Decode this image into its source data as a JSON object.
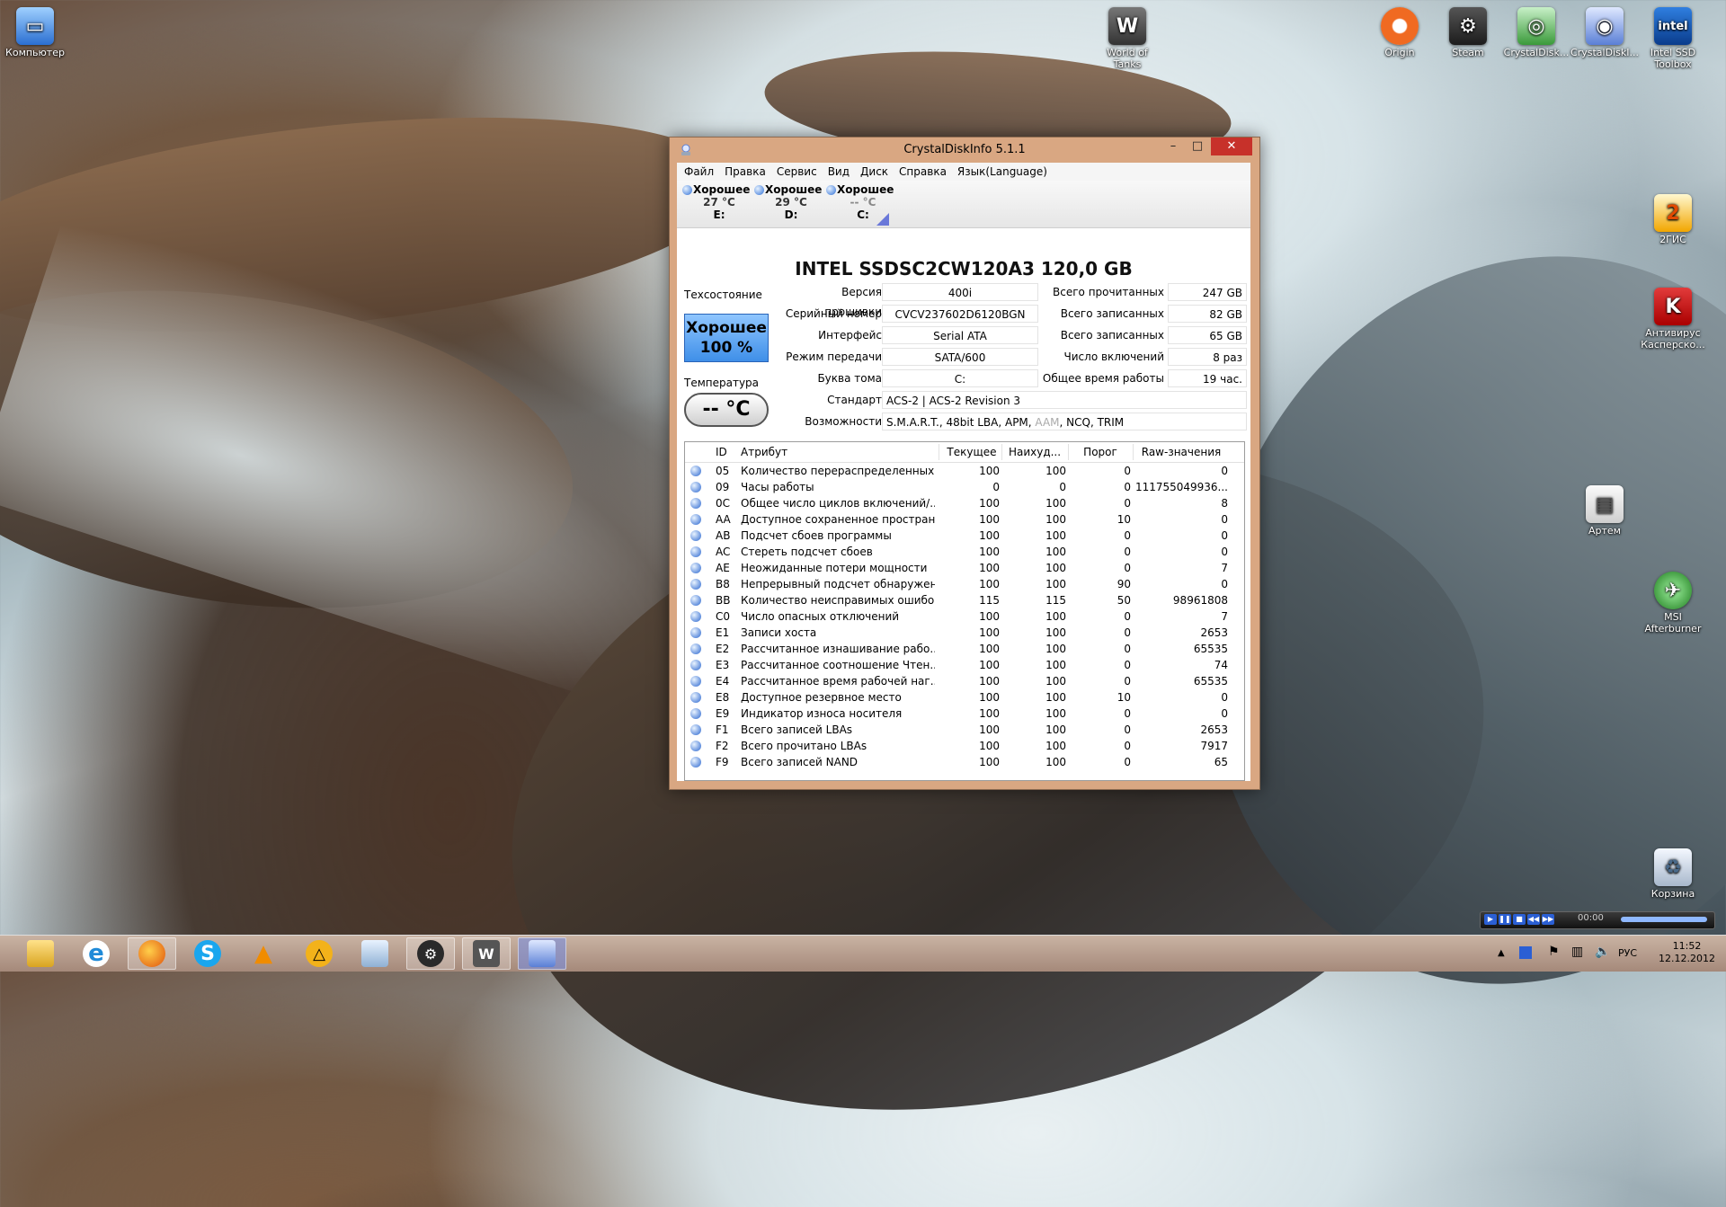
{
  "desktop": {
    "icons": [
      {
        "label": "Компьютер"
      },
      {
        "label": "World of Tanks"
      },
      {
        "label": "Origin"
      },
      {
        "label": "Steam"
      },
      {
        "label": "CrystalDisk..."
      },
      {
        "label": "CrystalDiskI..."
      },
      {
        "label": "Intel SSD Toolbox"
      },
      {
        "label": "2ГИС"
      },
      {
        "label": "Антивирус Касперско..."
      },
      {
        "label": "Артем"
      },
      {
        "label": "MSI Afterburner"
      },
      {
        "label": "Корзина"
      }
    ]
  },
  "window": {
    "title": "CrystalDiskInfo 5.1.1",
    "min": "–",
    "max": "□",
    "close": "✕",
    "menu": [
      "Файл",
      "Правка",
      "Сервис",
      "Вид",
      "Диск",
      "Справка",
      "Язык(Language)"
    ],
    "drives": [
      {
        "status": "Хорошее",
        "temp": "27 °C",
        "letter": "E:"
      },
      {
        "status": "Хорошее",
        "temp": "29 °C",
        "letter": "D:"
      },
      {
        "status": "Хорошее",
        "temp": "-- °C",
        "letter": "C:"
      }
    ],
    "model": "INTEL SSDSC2CW120A3  120,0 GB",
    "health_label": "Техсостояние",
    "health_status": "Хорошее",
    "health_percent": "100 %",
    "temp_label": "Температура",
    "temp_value": "-- °C",
    "fields": {
      "firmware_label": "Версия прошивки",
      "firmware": "400i",
      "serial_label": "Серийный номер",
      "serial": "CVCV237602D6120BGN",
      "interface_label": "Интерфейс",
      "interface": "Serial ATA",
      "transfer_label": "Режим передачи",
      "transfer": "SATA/600",
      "volume_label": "Буква тома",
      "volume": "C:",
      "standard_label": "Стандарт",
      "standard": "ACS-2 | ACS-2 Revision 3",
      "features_label": "Возможности",
      "features_a": "S.M.A.R.T., 48bit LBA, APM, ",
      "features_dim": "AAM",
      "features_b": ", NCQ, TRIM",
      "total_read_label": "Всего прочитанных",
      "total_read": "247 GB",
      "total_write_label": "Всего записанных",
      "total_write": "82 GB",
      "total_write2_label": "Всего записанных",
      "total_write2": "65 GB",
      "power_on_count_label": "Число включений",
      "power_on_count": "8 раз",
      "power_on_hours_label": "Общее время работы",
      "power_on_hours": "19 час."
    },
    "smart": {
      "headers": {
        "id": "ID",
        "attr": "Атрибут",
        "cur": "Текущее",
        "worst": "Наихуд...",
        "thr": "Порог",
        "raw": "Raw-значения"
      },
      "rows": [
        {
          "id": "05",
          "attr": "Количество перераспределенных...",
          "cur": "100",
          "worst": "100",
          "thr": "0",
          "raw": "0"
        },
        {
          "id": "09",
          "attr": "Часы работы",
          "cur": "0",
          "worst": "0",
          "thr": "0",
          "raw": "111755049936..."
        },
        {
          "id": "0C",
          "attr": "Общее число циклов включений/...",
          "cur": "100",
          "worst": "100",
          "thr": "0",
          "raw": "8"
        },
        {
          "id": "AA",
          "attr": "Доступное сохраненное простран...",
          "cur": "100",
          "worst": "100",
          "thr": "10",
          "raw": "0"
        },
        {
          "id": "AB",
          "attr": "Подсчет сбоев программы",
          "cur": "100",
          "worst": "100",
          "thr": "0",
          "raw": "0"
        },
        {
          "id": "AC",
          "attr": "Стереть подсчет сбоев",
          "cur": "100",
          "worst": "100",
          "thr": "0",
          "raw": "0"
        },
        {
          "id": "AE",
          "attr": "Неожиданные потери мощности",
          "cur": "100",
          "worst": "100",
          "thr": "0",
          "raw": "7"
        },
        {
          "id": "B8",
          "attr": "Непрерывный подсчет обнаружен...",
          "cur": "100",
          "worst": "100",
          "thr": "90",
          "raw": "0"
        },
        {
          "id": "BB",
          "attr": "Количество неисправимых ошибок",
          "cur": "115",
          "worst": "115",
          "thr": "50",
          "raw": "98961808"
        },
        {
          "id": "C0",
          "attr": "Число опасных отключений",
          "cur": "100",
          "worst": "100",
          "thr": "0",
          "raw": "7"
        },
        {
          "id": "E1",
          "attr": "Записи хоста",
          "cur": "100",
          "worst": "100",
          "thr": "0",
          "raw": "2653"
        },
        {
          "id": "E2",
          "attr": "Рассчитанное изнашивание рабо...",
          "cur": "100",
          "worst": "100",
          "thr": "0",
          "raw": "65535"
        },
        {
          "id": "E3",
          "attr": "Рассчитанное соотношение Чтен...",
          "cur": "100",
          "worst": "100",
          "thr": "0",
          "raw": "74"
        },
        {
          "id": "E4",
          "attr": "Рассчитанное время рабочей наг...",
          "cur": "100",
          "worst": "100",
          "thr": "0",
          "raw": "65535"
        },
        {
          "id": "E8",
          "attr": "Доступное резервное место",
          "cur": "100",
          "worst": "100",
          "thr": "10",
          "raw": "0"
        },
        {
          "id": "E9",
          "attr": "Индикатор износа носителя",
          "cur": "100",
          "worst": "100",
          "thr": "0",
          "raw": "0"
        },
        {
          "id": "F1",
          "attr": "Всего записей LBAs",
          "cur": "100",
          "worst": "100",
          "thr": "0",
          "raw": "2653"
        },
        {
          "id": "F2",
          "attr": "Всего прочитано LBAs",
          "cur": "100",
          "worst": "100",
          "thr": "0",
          "raw": "7917"
        },
        {
          "id": "F9",
          "attr": "Всего записей NAND",
          "cur": "100",
          "worst": "100",
          "thr": "0",
          "raw": "65"
        }
      ]
    }
  },
  "taskbar": {
    "lang": "РУС",
    "time": "11:52",
    "date": "12.12.2012",
    "player_time": "00:00"
  }
}
